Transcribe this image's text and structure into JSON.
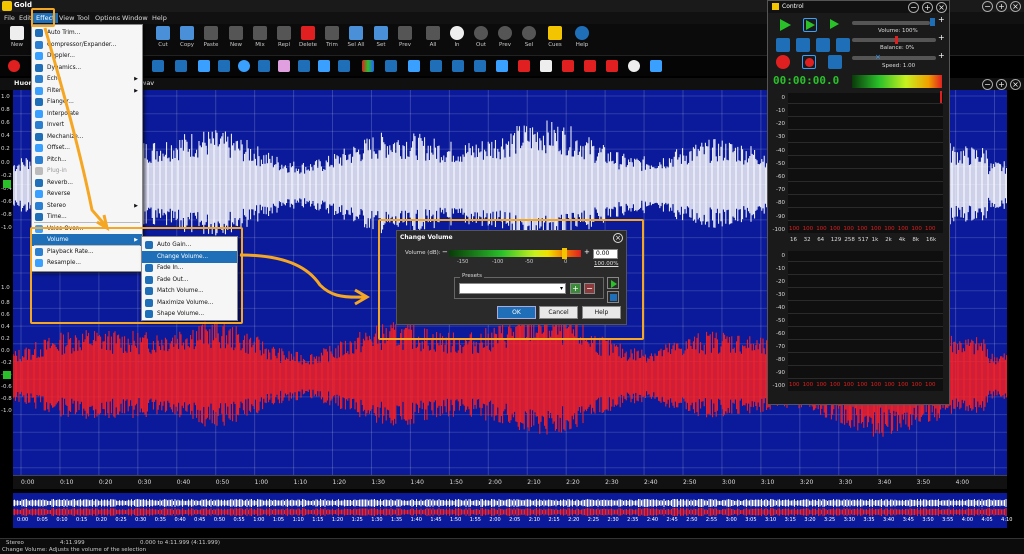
{
  "app": {
    "title": "Gold",
    "menu": [
      "File",
      "Edit",
      "Effect",
      "View",
      "Tool",
      "Options",
      "Window",
      "Help"
    ]
  },
  "toolbar1": [
    {
      "label": "New",
      "icon": "new-file-icon"
    },
    {
      "label": "Cut",
      "icon": "cut-icon"
    },
    {
      "label": "Copy",
      "icon": "copy-icon"
    },
    {
      "label": "Paste",
      "icon": "paste-icon"
    },
    {
      "label": "New",
      "icon": "paste-new-icon"
    },
    {
      "label": "Mix",
      "icon": "mix-icon"
    },
    {
      "label": "Repl",
      "icon": "replace-icon"
    },
    {
      "label": "Delete",
      "icon": "delete-icon"
    },
    {
      "label": "Trim",
      "icon": "trim-icon"
    },
    {
      "label": "Sel All",
      "icon": "select-all-icon"
    },
    {
      "label": "Set",
      "icon": "set-icon"
    },
    {
      "label": "Prev",
      "icon": "previous-icon"
    },
    {
      "label": "All",
      "icon": "zoom-all-icon"
    },
    {
      "label": "In",
      "icon": "zoom-in-icon"
    },
    {
      "label": "Out",
      "icon": "zoom-out-icon"
    },
    {
      "label": "Prev",
      "icon": "zoom-prev-icon"
    },
    {
      "label": "Sel",
      "icon": "zoom-sel-icon"
    },
    {
      "label": "Cues",
      "icon": "cues-icon"
    },
    {
      "label": "Help",
      "icon": "help-icon"
    }
  ],
  "wave": {
    "title": "Huong",
    "title_suffix": "wav",
    "y_labels_top": [
      "1.0",
      "0.8",
      "0.6",
      "0.4",
      "0.2",
      "0.0",
      "-0.2",
      "-0.4",
      "-0.6",
      "-0.8",
      "-1.0"
    ],
    "y_labels_bottom": [
      "1.0",
      "0.8",
      "0.6",
      "0.4",
      "0.2",
      "0.0",
      "-0.2",
      "-0.4",
      "-0.6",
      "-0.8",
      "-1.0"
    ],
    "time_labels": [
      "0:00",
      "0:10",
      "0:20",
      "0:30",
      "0:40",
      "0:50",
      "1:00",
      "1:10",
      "1:20",
      "1:30",
      "1:40",
      "1:50",
      "2:00",
      "2:10",
      "2:20",
      "2:30",
      "2:40",
      "2:50",
      "3:00",
      "3:10",
      "3:20",
      "3:30",
      "3:40",
      "3:50",
      "4:00"
    ],
    "overview_labels": [
      "0:00",
      "0:05",
      "0:10",
      "0:15",
      "0:20",
      "0:25",
      "0:30",
      "0:35",
      "0:40",
      "0:45",
      "0:50",
      "0:55",
      "1:00",
      "1:05",
      "1:10",
      "1:15",
      "1:20",
      "1:25",
      "1:30",
      "1:35",
      "1:40",
      "1:45",
      "1:50",
      "1:55",
      "2:00",
      "2:05",
      "2:10",
      "2:15",
      "2:20",
      "2:25",
      "2:30",
      "2:35",
      "2:40",
      "2:45",
      "2:50",
      "2:55",
      "3:00",
      "3:05",
      "3:10",
      "3:15",
      "3:20",
      "3:25",
      "3:30",
      "3:35",
      "3:40",
      "3:45",
      "3:50",
      "3:55",
      "4:00",
      "4:05",
      "4:10"
    ],
    "colors": {
      "background": "#0a1a9a",
      "left_channel": "#ffffff",
      "right_channel": "#ff2020"
    }
  },
  "effect_menu": {
    "items": [
      {
        "label": "Auto Trim...",
        "sub": false,
        "dis": false
      },
      {
        "label": "Compressor/Expander...",
        "sub": false,
        "dis": false
      },
      {
        "label": "Doppler...",
        "sub": false,
        "dis": false
      },
      {
        "label": "Dynamics...",
        "sub": false,
        "dis": false
      },
      {
        "label": "Echo",
        "sub": true,
        "dis": false
      },
      {
        "label": "Filter",
        "sub": true,
        "dis": false
      },
      {
        "label": "Flanger...",
        "sub": false,
        "dis": false
      },
      {
        "label": "Interpolate",
        "sub": false,
        "dis": false
      },
      {
        "label": "Invert",
        "sub": false,
        "dis": false
      },
      {
        "label": "Mechanize...",
        "sub": false,
        "dis": false
      },
      {
        "label": "Offset...",
        "sub": false,
        "dis": false
      },
      {
        "label": "Pitch...",
        "sub": false,
        "dis": false
      },
      {
        "label": "Plug-in",
        "sub": false,
        "dis": true
      },
      {
        "label": "Reverb...",
        "sub": false,
        "dis": false
      },
      {
        "label": "Reverse",
        "sub": false,
        "dis": false
      },
      {
        "label": "Stereo",
        "sub": true,
        "dis": false
      },
      {
        "label": "Time...",
        "sub": false,
        "dis": false
      },
      {
        "label": "Voice Over...",
        "sub": false,
        "dis": false
      },
      {
        "label": "Volume",
        "sub": true,
        "dis": false,
        "sel": true
      },
      {
        "label": "Playback Rate...",
        "sub": false,
        "dis": false
      },
      {
        "label": "Resample...",
        "sub": false,
        "dis": false
      }
    ]
  },
  "volume_submenu": {
    "items": [
      "Auto Gain...",
      "Change Volume...",
      "Fade In...",
      "Fade Out...",
      "Match Volume...",
      "Maximize Volume...",
      "Shape Volume..."
    ],
    "selected": 1
  },
  "dialog": {
    "title": "Change Volume",
    "volume_label": "Volume (dB):",
    "scale": [
      "-150",
      "-100",
      "-50",
      "0"
    ],
    "value": "0.00",
    "percent": "100.00%",
    "presets_label": "Presets",
    "ok": "OK",
    "cancel": "Cancel",
    "help": "Help"
  },
  "control": {
    "title": "Control",
    "volume": "Volume: 100%",
    "balance": "Balance: 0%",
    "speed": "Speed: 1.00",
    "time": "00:00:00.0",
    "vu_left": [
      "0",
      "-10",
      "-20",
      "-30",
      "-40",
      "-50",
      "-60",
      "-70",
      "-80",
      "-90",
      "-100"
    ],
    "vu_right": [
      "0",
      "-10",
      "-20",
      "-30",
      "-40",
      "-50",
      "-60",
      "-70",
      "-80",
      "-90",
      "-100"
    ],
    "freqs": [
      "16",
      "32",
      "64",
      "129",
      "258",
      "517",
      "1k",
      "2k",
      "4k",
      "8k",
      "16k"
    ],
    "peak": "100"
  },
  "status": {
    "mode": "Stereo",
    "length": "4:11.999",
    "selection": "0.000 to 4:11.999 (4:11.999)",
    "message": "Change Volume: Adjusts the volume of the selection"
  }
}
